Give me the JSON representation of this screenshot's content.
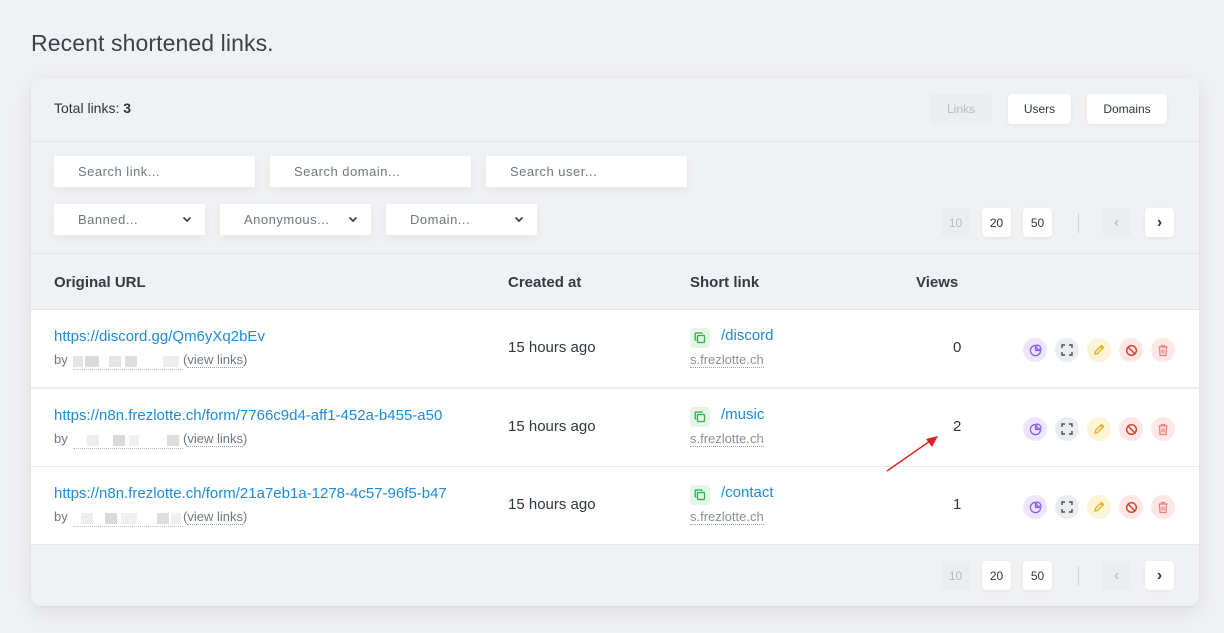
{
  "page_title": "Recent shortened links.",
  "header": {
    "total_label": "Total links: ",
    "total_count": "3",
    "tabs": [
      "Links",
      "Users",
      "Domains"
    ]
  },
  "filters": {
    "search_link": "Search link...",
    "search_domain": "Search domain...",
    "search_user": "Search user...",
    "banned": "Banned...",
    "anonymous": "Anonymous...",
    "domain": "Domain..."
  },
  "pagination": {
    "sizes": [
      "10",
      "20",
      "50"
    ],
    "prev": "‹",
    "next": "›"
  },
  "table": {
    "columns": [
      "Original URL",
      "Created at",
      "Short link",
      "Views"
    ],
    "rows": [
      {
        "url": "https://discord.gg/Qm6yXq2bEv",
        "by": "by",
        "view_links_open": "(",
        "view_links": "view links",
        "view_links_close": ")",
        "created": "15 hours ago",
        "short": "/discord",
        "domain": "s.frezlotte.ch",
        "views": "0"
      },
      {
        "url": "https://n8n.frezlotte.ch/form/7766c9d4-aff1-452a-b455-a50",
        "by": "by",
        "view_links_open": "(",
        "view_links": "view links",
        "view_links_close": ")",
        "created": "15 hours ago",
        "short": "/music",
        "domain": "s.frezlotte.ch",
        "views": "2"
      },
      {
        "url": "https://n8n.frezlotte.ch/form/21a7eb1a-1278-4c57-96f5-b47",
        "by": "by",
        "view_links_open": "(",
        "view_links": "view links",
        "view_links_close": ")",
        "created": "15 hours ago",
        "short": "/contact",
        "domain": "s.frezlotte.ch",
        "views": "1"
      }
    ]
  },
  "colors": {
    "link": "#1d8bd8",
    "stats": "#8b5cf6",
    "edit": "#e0b21b",
    "ban": "#d83b2c",
    "delete": "#f07d7d",
    "copy": "#38a84f",
    "annotation_arrow": "#e02020"
  }
}
